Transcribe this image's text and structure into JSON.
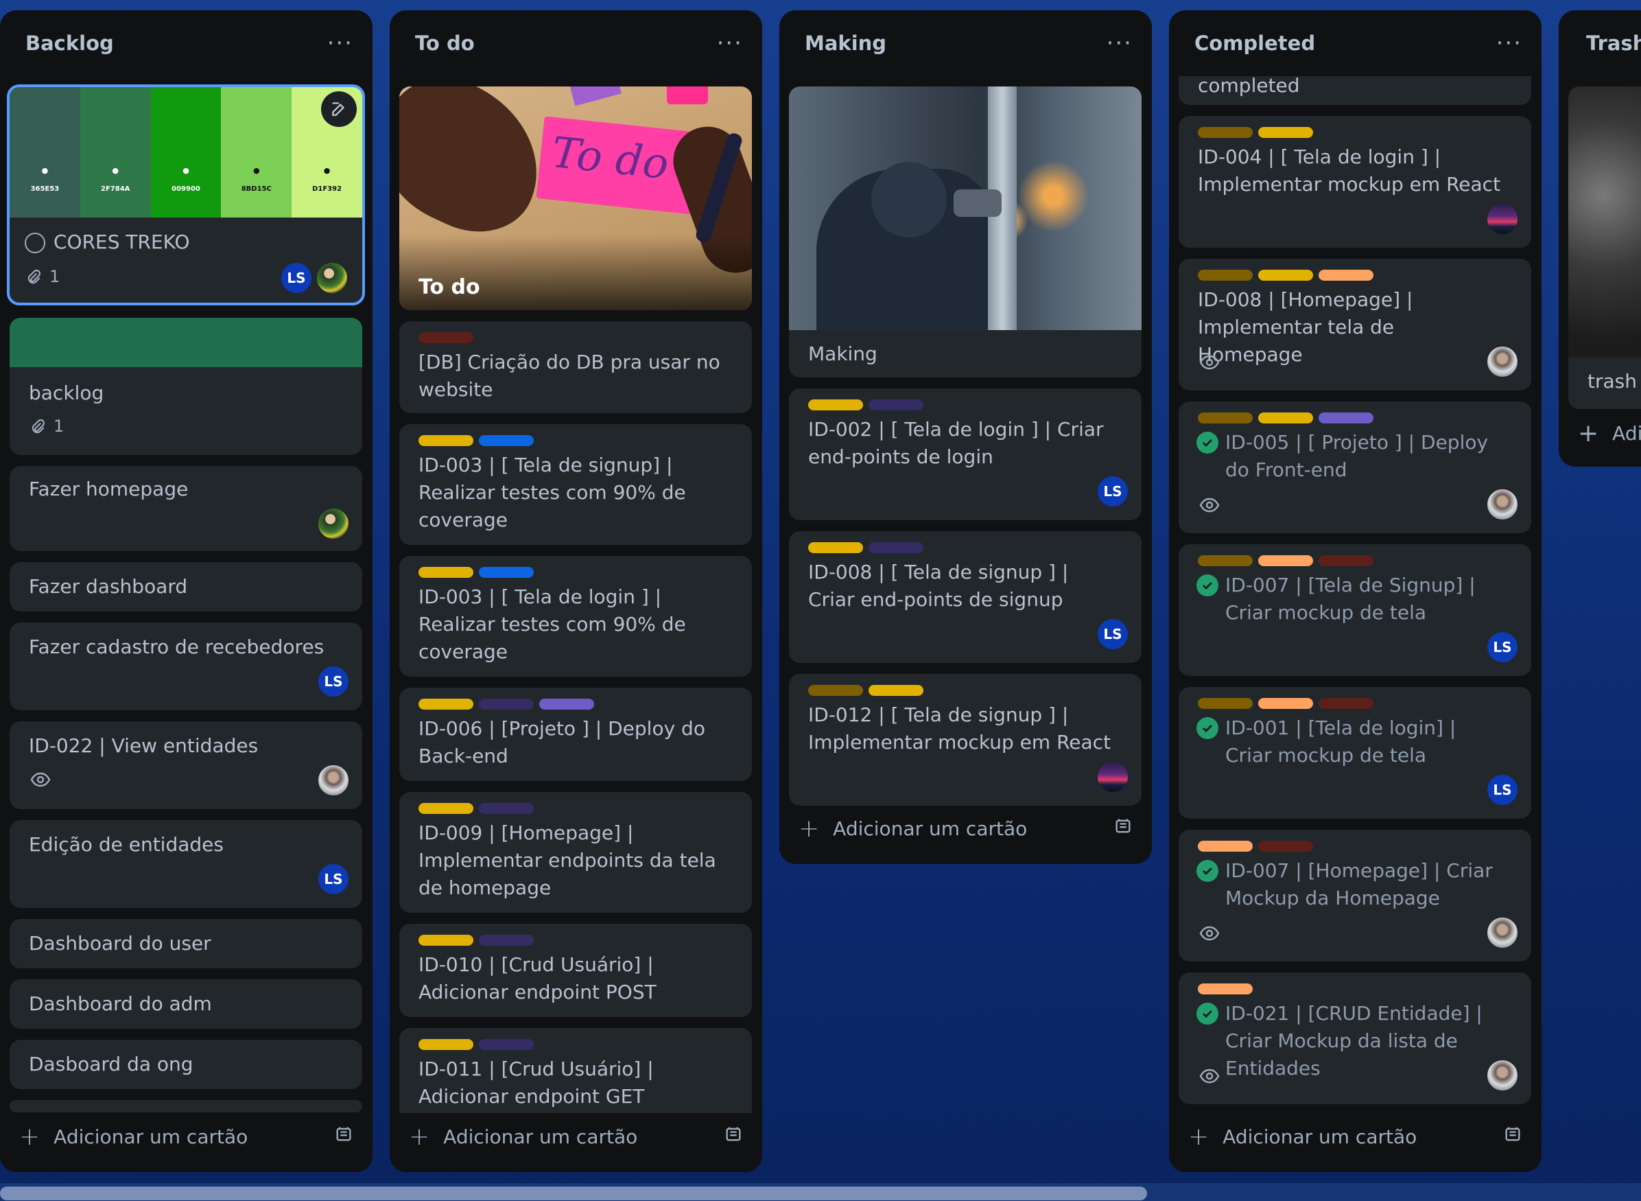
{
  "columns": {
    "backlog": {
      "title": "Backlog",
      "cover_card": {
        "swatches": [
          {
            "hex": "365E53",
            "label": "",
            "color": "#365e53"
          },
          {
            "hex": "2F784A",
            "label": "",
            "color": "#2f784a"
          },
          {
            "hex": "009900",
            "label": "",
            "color": "#119a0e"
          },
          {
            "hex": "8BD15C",
            "label": "",
            "color": "#7bcf54"
          },
          {
            "hex": "D1F392",
            "label": "",
            "color": "#c9f281"
          }
        ],
        "title": "CORES TREKO",
        "attachments": "1",
        "avatar": "LS"
      },
      "cards": [
        {
          "title": "backlog",
          "attachments": "1",
          "cover_color": "#216e4e"
        },
        {
          "title": "Fazer homepage"
        },
        {
          "title": "Fazer dashboard"
        },
        {
          "title": "Fazer cadastro de recebedores",
          "avatar": "LS"
        },
        {
          "title": "ID-022 | View entidades"
        },
        {
          "title": "Edição de entidades",
          "avatar": "LS"
        },
        {
          "title": "Dashboard do user"
        },
        {
          "title": "Dashboard do adm"
        },
        {
          "title": "Dasboard da ong"
        }
      ],
      "add_label": "Adicionar um cartão"
    },
    "todo": {
      "title": "To do",
      "cover_card": {
        "title": "To do",
        "note_text": "To do"
      },
      "cards": [
        {
          "title": "[DB] Criação do DB pra usar no website",
          "labels": [
            "#ae2e24"
          ]
        },
        {
          "title": "ID-003 | [ Tela de signup] | Realizar testes com 90% de coverage",
          "labels": [
            "#e2b203",
            "#0c66e4"
          ]
        },
        {
          "title": "ID-003 | [ Tela de login ] | Realizar testes com 90% de coverage",
          "labels": [
            "#e2b203",
            "#0c66e4"
          ]
        },
        {
          "title": "ID-006 | [Projeto ] | Deploy do Back-end",
          "labels": [
            "#e2b203",
            "#352c63",
            "#6e5dc6"
          ]
        },
        {
          "title": "ID-009 | [Homepage] | Implementar endpoints da tela de homepage",
          "labels": [
            "#e2b203",
            "#352c63"
          ]
        },
        {
          "title": "ID-010 | [Crud Usuário] | Adicionar endpoint POST",
          "labels": [
            "#e2b203",
            "#352c63"
          ]
        },
        {
          "title": "ID-011 | [Crud Usuário] | Adicionar endpoint GET",
          "labels": [
            "#e2b203",
            "#352c63"
          ]
        }
      ],
      "add_label": "Adicionar um cartão"
    },
    "making": {
      "title": "Making",
      "cover_card": {
        "title": "Making"
      },
      "cards": [
        {
          "title": "ID-002 | [ Tela de login ] | Criar end-points de login",
          "labels": [
            "#e2b203",
            "#352c63"
          ],
          "avatar": "LS"
        },
        {
          "title": "ID-008 | [ Tela de signup ] | Criar end-points de signup",
          "labels": [
            "#e2b203",
            "#352c63"
          ],
          "avatar": "LS"
        },
        {
          "title": "ID-012 | [ Tela de signup ] | Implementar mockup em React",
          "labels": [
            "#7f5f01",
            "#e2b203"
          ]
        }
      ],
      "add_label": "Adicionar um cartão"
    },
    "completed": {
      "title": "Completed",
      "cards": [
        {
          "title": "completed"
        },
        {
          "title": "ID-004 | [ Tela de login ] | Implementar mockup em React",
          "labels": [
            "#7f5f01",
            "#e2b203"
          ]
        },
        {
          "title": "ID-008 | [Homepage] | Implementar tela de Homepage",
          "labels": [
            "#7f5f01",
            "#e2b203",
            "#fea362"
          ]
        },
        {
          "title": "ID-005 | [ Projeto ] | Deploy do Front-end",
          "labels": [
            "#7f5f01",
            "#e2b203",
            "#6e5dc6"
          ]
        },
        {
          "title": "ID-007 | [Tela de Signup] | Criar mockup de tela",
          "labels": [
            "#7f5f01",
            "#fea362",
            "#5d1f1a"
          ],
          "avatar": "LS"
        },
        {
          "title": "ID-001 | [Tela de login] | Criar mockup de tela",
          "labels": [
            "#7f5f01",
            "#fea362",
            "#5d1f1a"
          ],
          "avatar": "LS"
        },
        {
          "title": "ID-007 | [Homepage] | Criar Mockup da Homepage",
          "labels": [
            "#fea362",
            "#5d1f1a"
          ]
        },
        {
          "title": "ID-021 | [CRUD Entidade] | Criar Mockup da lista de Entidades",
          "labels": [
            "#fea362"
          ]
        }
      ],
      "add_label": "Adicionar um cartão"
    },
    "trash": {
      "title": "Trash",
      "cards": [
        {
          "title": "trash"
        }
      ],
      "add_label": "Adicionar um cartão"
    }
  },
  "icons": {
    "more": "ellipsis-icon",
    "add": "plus-icon",
    "template": "card-template-icon",
    "edit": "pencil-edit-icon",
    "watch": "eye-icon",
    "attachment": "paperclip-icon",
    "complete": "check-circle-icon"
  },
  "colors": {
    "list_bg": "#101204",
    "card_bg": "#22272b",
    "avatar_bg": "#0c3bb8",
    "check_green": "#22a06b",
    "selected_border": "#579dff"
  }
}
